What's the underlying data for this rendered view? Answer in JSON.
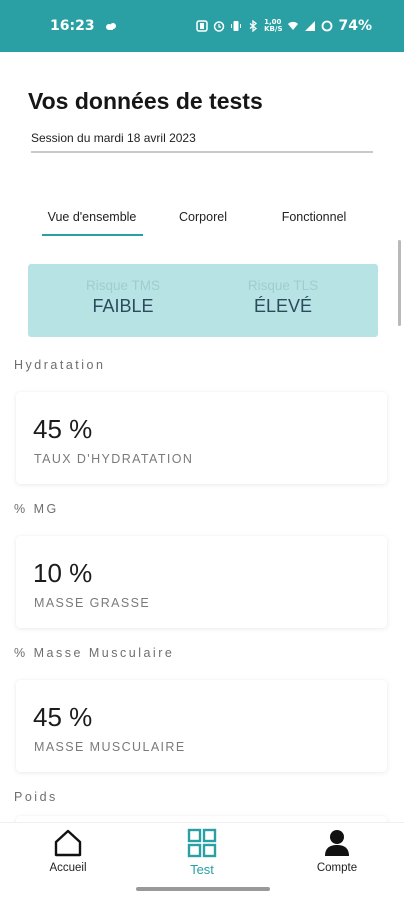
{
  "status_bar": {
    "time": "16:23",
    "network": "1,00\nKB/S",
    "battery": "74%"
  },
  "header": {
    "title": "Vos données de tests",
    "session": "Session du mardi 18 avril 2023"
  },
  "tabs": [
    {
      "label": "Vue d'ensemble",
      "active": true
    },
    {
      "label": "Corporel",
      "active": false
    },
    {
      "label": "Fonctionnel",
      "active": false
    }
  ],
  "risk": {
    "tms_label": "Risque TMS",
    "tms_value": "FAIBLE",
    "tls_label": "Risque TLS",
    "tls_value": "ÉLEVÉ"
  },
  "sections": {
    "hydration": {
      "label": "Hydratation",
      "value": "45 %",
      "caption": "TAUX D'HYDRATATION"
    },
    "fat": {
      "label": "% MG",
      "value": "10 %",
      "caption": "MASSE GRASSE"
    },
    "muscle": {
      "label": "% Masse Musculaire",
      "value": "45 %",
      "caption": "MASSE MUSCULAIRE"
    },
    "weight": {
      "label": "Poids"
    }
  },
  "bottom_nav": [
    {
      "label": "Accueil",
      "icon": "home-icon",
      "active": false
    },
    {
      "label": "Test",
      "icon": "grid-icon",
      "active": true
    },
    {
      "label": "Compte",
      "icon": "user-icon",
      "active": false
    }
  ],
  "colors": {
    "accent": "#2aa0a4",
    "risk_bg": "#b8e3e5",
    "risk_value": "#2b4b5d"
  }
}
